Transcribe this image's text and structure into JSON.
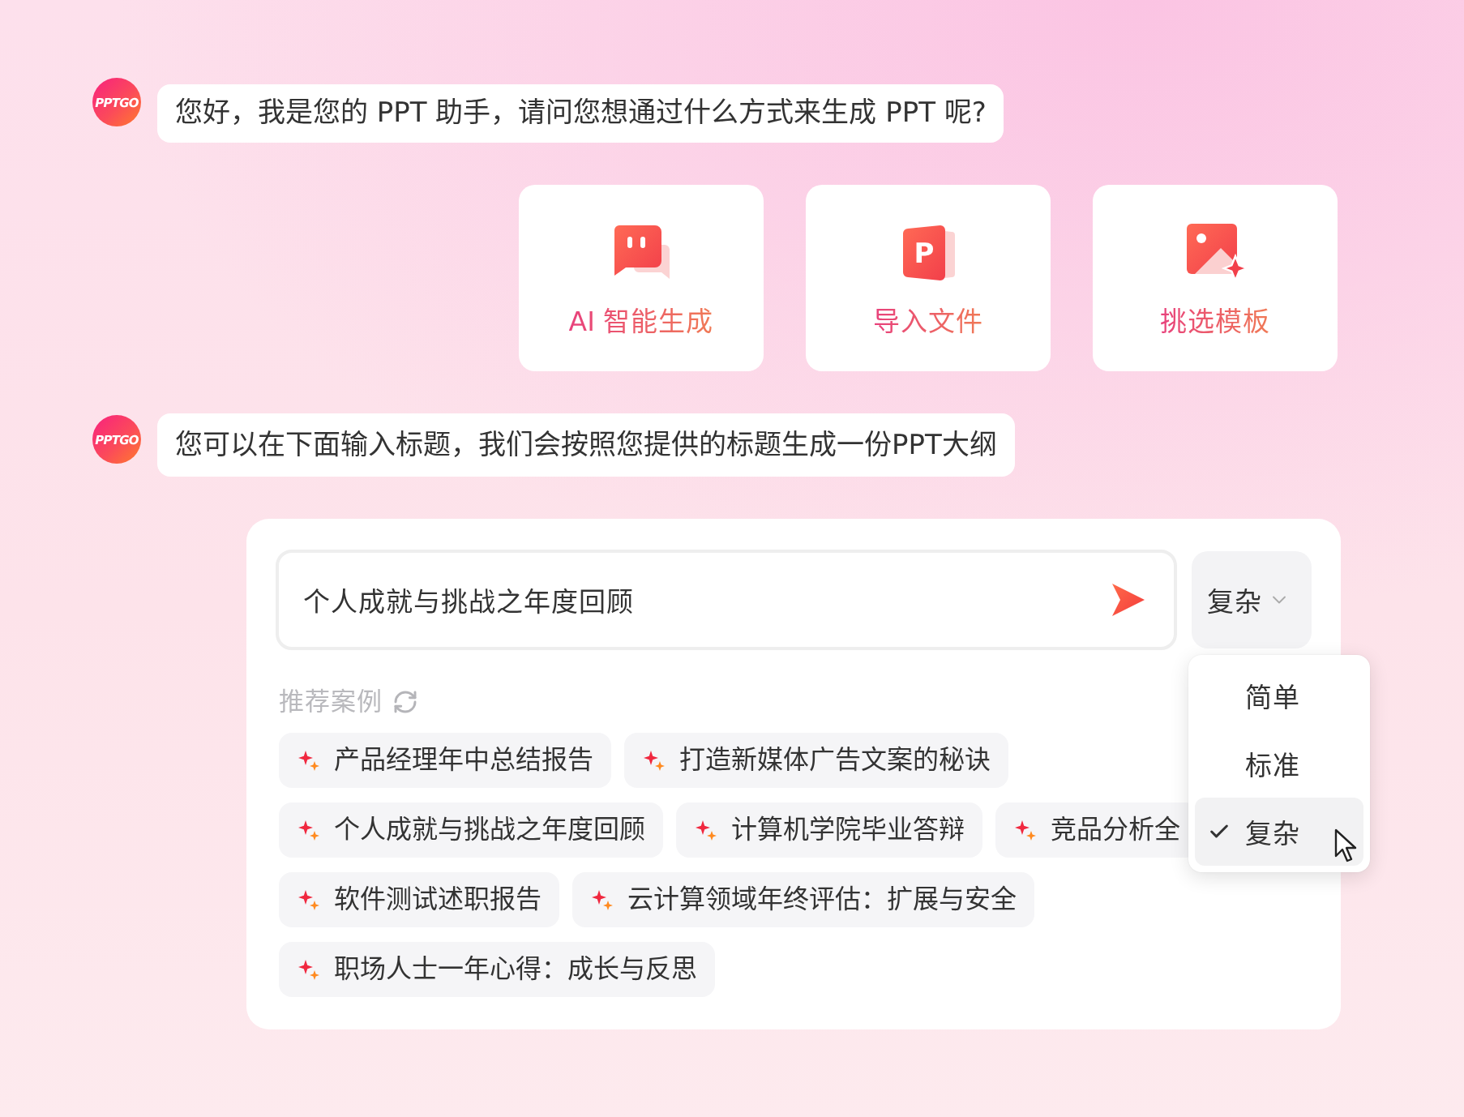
{
  "greeting": {
    "avatar": "PPTGO",
    "text": "您好，我是您的 PPT 助手，请问您想通过什么方式来生成 PPT 呢?"
  },
  "mode_cards": [
    {
      "kind": "chat",
      "label": "AI 智能生成"
    },
    {
      "kind": "document",
      "icon_letter": "P",
      "label": "导入文件"
    },
    {
      "kind": "image",
      "label": "挑选模板"
    }
  ],
  "prompt_message": {
    "avatar": "PPTGO",
    "text": "您可以在下面输入标题，我们会按照您提供的标题生成一份PPT大纲"
  },
  "composer": {
    "input": {
      "value": "个人成就与挑战之年度回顾"
    },
    "complexity": {
      "value": "复杂",
      "expanded": true,
      "options": [
        {
          "label": "简单",
          "selected": false
        },
        {
          "label": "标准",
          "selected": false
        },
        {
          "label": "复杂",
          "selected": true
        }
      ]
    },
    "suggestions_label": "推荐案例",
    "suggestions": [
      "产品经理年中总结报告",
      "打造新媒体广告文案的秘诀",
      "个人成就与挑战之年度回顾",
      "计算机学院毕业答辩",
      "竞品分析全",
      "软件测试述职报告",
      "云计算领域年终评估：扩展与安全",
      "职场人士一年心得：成长与反思"
    ]
  }
}
